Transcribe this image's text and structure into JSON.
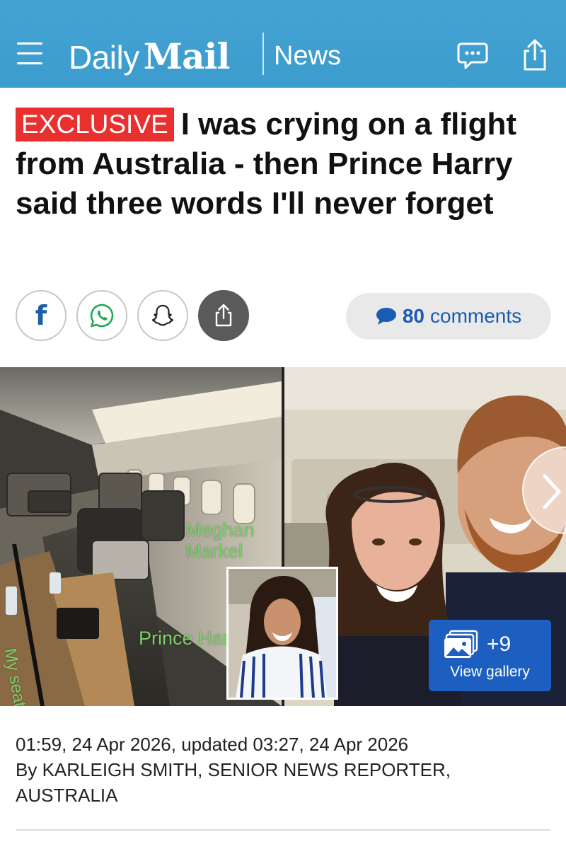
{
  "header": {
    "logo_daily": "Daily",
    "logo_mail": "Mail",
    "section": "News",
    "background_color": "#3f9fcf"
  },
  "headline": {
    "badge": "EXCLUSIVE",
    "title": "I was crying on a flight from Australia - then Prince Harry said three words I'll never forget",
    "badge_color": "#e8302f"
  },
  "social": {
    "facebook_icon": "facebook-icon",
    "whatsapp_icon": "whatsapp-icon",
    "snapchat_icon": "snapchat-icon",
    "share_icon": "share-icon",
    "comments_count": "80",
    "comments_label": "comments"
  },
  "image": {
    "labels": {
      "meghan": "Meghan Markel",
      "harry": "Prince Harry",
      "my_seat": "My seat"
    },
    "gallery_count": "+9",
    "gallery_label": "View gallery"
  },
  "meta": {
    "timestamp": "01:59, 24 Apr 2026, updated 03:27, 24 Apr 2026",
    "byline": "By KARLEIGH SMITH, SENIOR NEWS REPORTER, AUSTRALIA"
  }
}
